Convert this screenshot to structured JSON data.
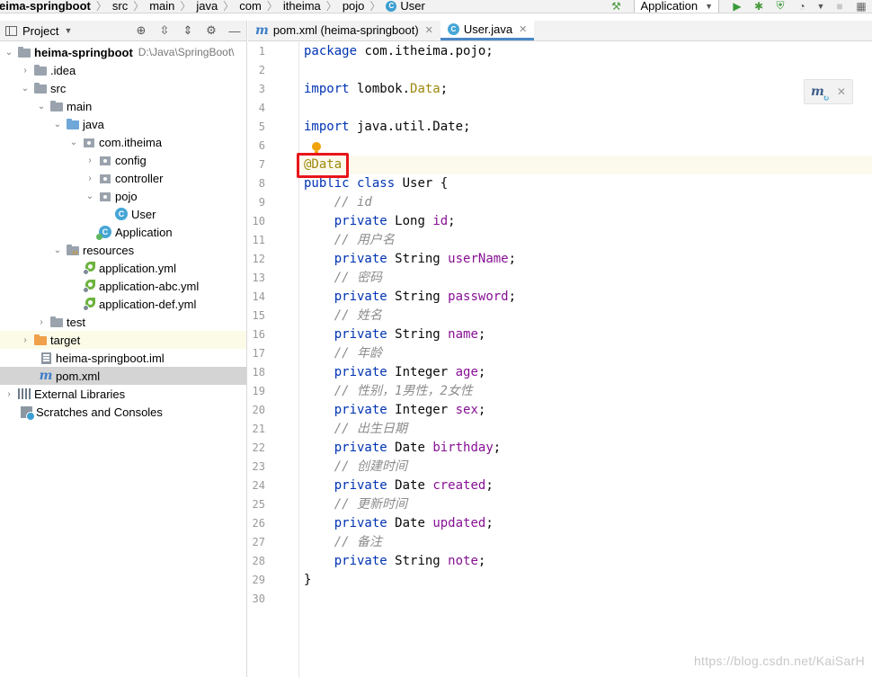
{
  "breadcrumb": [
    "eima-springboot",
    "src",
    "main",
    "java",
    "com",
    "itheima",
    "pojo",
    "User"
  ],
  "toolbar": {
    "run_config": "Application",
    "icons": [
      "hammer-icon",
      "run-icon",
      "debug-icon",
      "coverage-icon",
      "profile-icon",
      "stop-icon",
      "grid-icon"
    ]
  },
  "project": {
    "title": "Project",
    "tools": [
      "locate-icon",
      "expand-all-icon",
      "collapse-all-icon",
      "gear-icon",
      "hide-icon"
    ],
    "tree": [
      {
        "label": "heima-springboot",
        "hint": "D:\\Java\\SpringBoot\\",
        "bold": true
      },
      {
        "label": ".idea"
      },
      {
        "label": "src"
      },
      {
        "label": "main"
      },
      {
        "label": "java"
      },
      {
        "label": "com.itheima"
      },
      {
        "label": "config"
      },
      {
        "label": "controller"
      },
      {
        "label": "pojo"
      },
      {
        "label": "User"
      },
      {
        "label": "Application"
      },
      {
        "label": "resources"
      },
      {
        "label": "application.yml"
      },
      {
        "label": "application-abc.yml"
      },
      {
        "label": "application-def.yml"
      },
      {
        "label": "test"
      },
      {
        "label": "target"
      },
      {
        "label": "heima-springboot.iml"
      },
      {
        "label": "pom.xml"
      },
      {
        "label": "External Libraries"
      },
      {
        "label": "Scratches and Consoles"
      }
    ]
  },
  "editor": {
    "tabs": [
      {
        "label": "pom.xml (heima-springboot)",
        "active": false
      },
      {
        "label": "User.java",
        "active": true
      }
    ],
    "code": {
      "l1_a": "package",
      "l1_b": " com.itheima.pojo;",
      "l3_a": "import",
      "l3_b": " lombok.",
      "l3_c": "Data",
      "l3_d": ";",
      "l5_a": "import",
      "l5_b": " java.util.Date;",
      "l7": "@Data",
      "l8_a": "public class",
      "l8_b": " User {",
      "l9": "// id",
      "l10_a": "private",
      "l10_b": " Long ",
      "l10_c": "id",
      "l10_d": ";",
      "l11": "// 用户名",
      "l12_a": "private",
      "l12_b": " String ",
      "l12_c": "userName",
      "l12_d": ";",
      "l13": "// 密码",
      "l14_a": "private",
      "l14_b": " String ",
      "l14_c": "password",
      "l14_d": ";",
      "l15": "// 姓名",
      "l16_a": "private",
      "l16_b": " String ",
      "l16_c": "name",
      "l16_d": ";",
      "l17": "// 年龄",
      "l18_a": "private",
      "l18_b": " Integer ",
      "l18_c": "age",
      "l18_d": ";",
      "l19": "// 性别，1男性，2女性",
      "l20_a": "private",
      "l20_b": " Integer ",
      "l20_c": "sex",
      "l20_d": ";",
      "l21": "// 出生日期",
      "l22_a": "private",
      "l22_b": " Date ",
      "l22_c": "birthday",
      "l22_d": ";",
      "l23": "// 创建时间",
      "l24_a": "private",
      "l24_b": " Date ",
      "l24_c": "created",
      "l24_d": ";",
      "l25": "// 更新时间",
      "l26_a": "private",
      "l26_b": " Date ",
      "l26_c": "updated",
      "l26_d": ";",
      "l27": "// 备注",
      "l28_a": "private",
      "l28_b": " String ",
      "l28_c": "note",
      "l28_d": ";",
      "l29": "}"
    },
    "line_numbers": [
      "1",
      "2",
      "3",
      "4",
      "5",
      "6",
      "7",
      "8",
      "9",
      "10",
      "11",
      "12",
      "13",
      "14",
      "15",
      "16",
      "17",
      "18",
      "19",
      "20",
      "21",
      "22",
      "23",
      "24",
      "25",
      "26",
      "27",
      "28",
      "29",
      "30"
    ]
  },
  "watermark": "https://blog.csdn.net/KaiSarH",
  "colors": {
    "keyword": "#0033b3",
    "annotation": "#9e880d",
    "field": "#871094",
    "comment": "#8c8c8c",
    "highlight_box": "#e8151a"
  }
}
